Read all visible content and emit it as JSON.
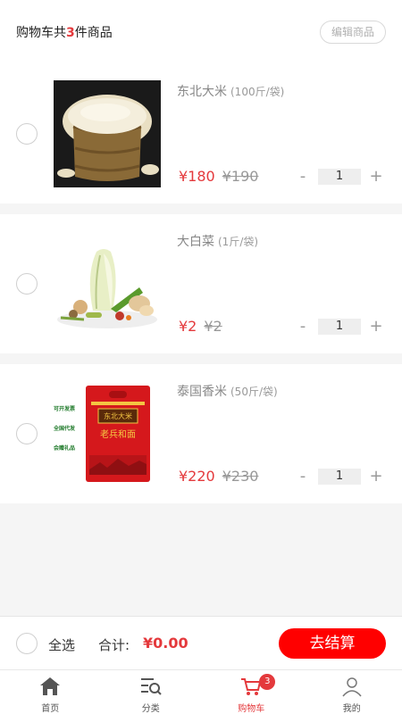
{
  "header": {
    "title_prefix": "购物车共",
    "count": "3",
    "title_suffix": "件商品",
    "edit_label": "编辑商品"
  },
  "items": [
    {
      "name": "东北大米",
      "spec": "(100斤/袋)",
      "price": "¥180",
      "old_price": "¥190",
      "qty": "1",
      "minus": "-",
      "plus": "+"
    },
    {
      "name": "大白菜",
      "spec": "(1斤/袋)",
      "price": "¥2",
      "old_price": "¥2",
      "qty": "1",
      "minus": "-",
      "plus": "+"
    },
    {
      "name": "泰国香米",
      "spec": "(50斤/袋)",
      "price": "¥220",
      "old_price": "¥230",
      "qty": "1",
      "minus": "-",
      "plus": "+"
    }
  ],
  "bag_text": {
    "brand": "东北大米",
    "slogan": "老兵和面",
    "side": [
      "可开发票",
      "全国代发",
      "会赠礼品"
    ]
  },
  "footer": {
    "select_all": "全选",
    "total_label": "合计:",
    "total_value": "¥0.00",
    "checkout": "去结算"
  },
  "tabs": [
    {
      "label": "首页",
      "icon": "home-icon"
    },
    {
      "label": "分类",
      "icon": "category-icon"
    },
    {
      "label": "购物车",
      "icon": "cart-icon",
      "badge": "3"
    },
    {
      "label": "我的",
      "icon": "user-icon"
    }
  ],
  "colors": {
    "accent": "#e4393c",
    "checkout_button": "#ff0000"
  }
}
